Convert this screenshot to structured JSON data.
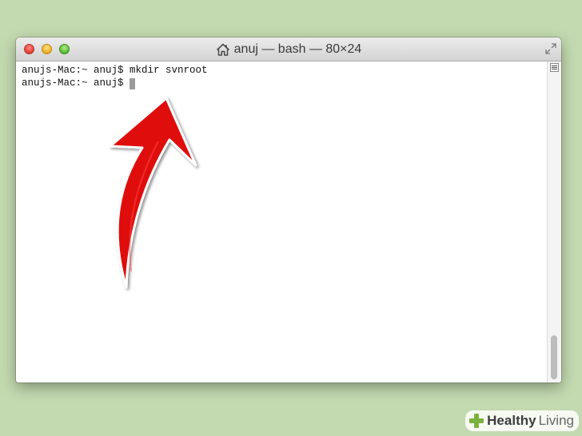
{
  "window": {
    "title": "anuj — bash — 80×24"
  },
  "terminal": {
    "lines": [
      "anujs-Mac:~ anuj$ mkdir svnroot",
      "anujs-Mac:~ anuj$ "
    ]
  },
  "icons": {
    "title_icon": "home-icon",
    "fullscreen": "fullscreen-icon",
    "split": "split-pane-icon",
    "annotation": "red-arrow-icon",
    "watermark_logo": "healthy-living-logo-icon"
  },
  "colors": {
    "background": "#c3dab0",
    "arrow": "#e01010",
    "cursor": "#9a9a9a",
    "watermark_cross": "#7bb23f"
  },
  "watermark": {
    "brand_bold": "Healthy",
    "brand_light": "Living"
  }
}
